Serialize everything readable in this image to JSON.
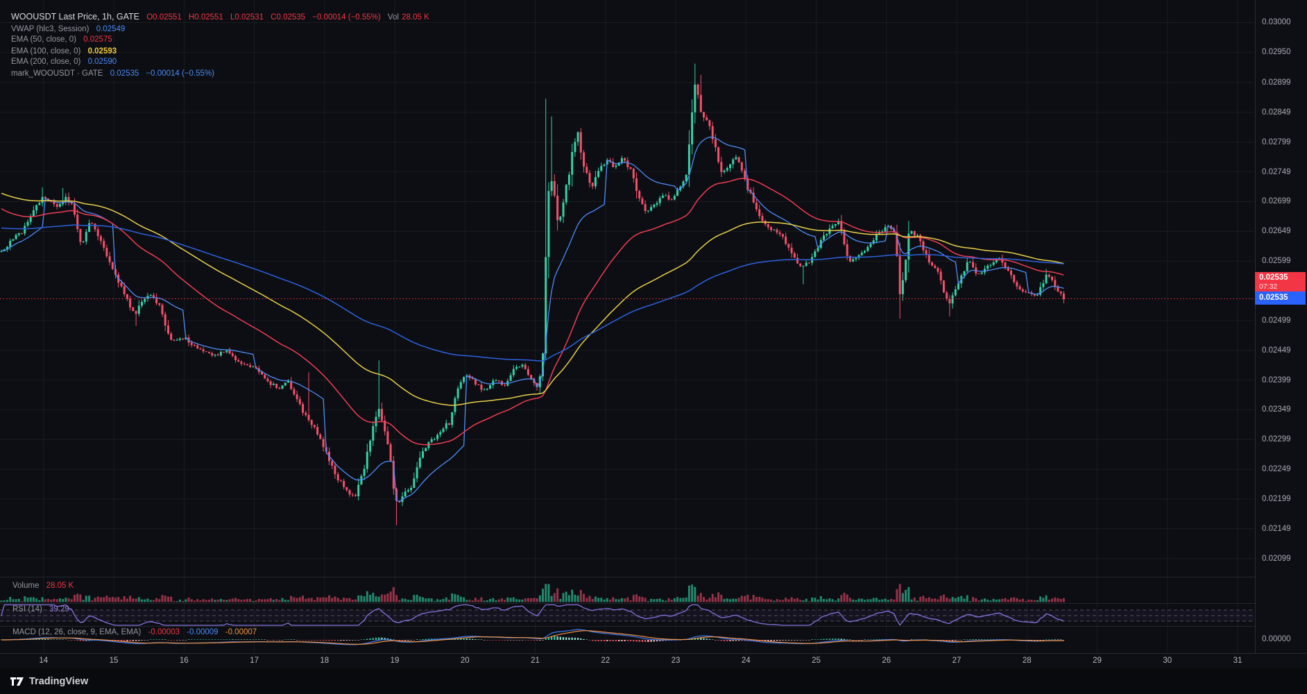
{
  "legend": {
    "row1": {
      "symbol": "WOOUSDT Last Price, 1h, GATE",
      "o": "O0.02551",
      "h": "H0.02551",
      "l": "L0.02531",
      "c": "C0.02535",
      "chg": "−0.00014 (−0.55%)",
      "vol_label": "Vol",
      "vol": "28.05 K"
    },
    "row2": {
      "name": "VWAP (hlc3, Session)",
      "value": "0.02549"
    },
    "row3": {
      "name": "EMA (50, close, 0)",
      "value": "0.02575"
    },
    "row4": {
      "name": "EMA (100, close, 0)",
      "value": "0.02593"
    },
    "row5": {
      "name": "EMA (200, close, 0)",
      "value": "0.02590"
    },
    "row6": {
      "name": "mark_WOOUSDT · GATE",
      "value": "0.02535",
      "chg": "−0.00014 (−0.55%)"
    }
  },
  "panes": {
    "volume_label": "Volume",
    "volume_value": "28.05 K",
    "rsi_label": "RSI (14)",
    "rsi_value": "39.29",
    "macd_label": "MACD (12, 26, close, 9, EMA, EMA)",
    "macd_v1": "-0.00003",
    "macd_v2": "-0.00009",
    "macd_v3": "-0.00007"
  },
  "tags": {
    "last_price": "0.02535",
    "countdown": "07:32",
    "mark_price": "0.02535"
  },
  "footer": {
    "brand": "TradingView"
  },
  "axis": {
    "price_labels": [
      "0.03000",
      "0.02950",
      "0.02899",
      "0.02849",
      "0.02799",
      "0.02749",
      "0.02699",
      "0.02649",
      "0.02599",
      "0.02499",
      "0.02449",
      "0.02399",
      "0.02349",
      "0.02299",
      "0.02249",
      "0.02199",
      "0.02149",
      "0.02099"
    ],
    "macd_zero_label": "0.00000",
    "time_labels": [
      "14",
      "15",
      "16",
      "17",
      "18",
      "19",
      "20",
      "21",
      "22",
      "23",
      "24",
      "25",
      "26",
      "27",
      "28",
      "29",
      "30",
      "31"
    ]
  },
  "colors": {
    "bg": "#0c0e13",
    "grid": "rgba(255,255,255,0.055)",
    "sep": "rgba(255,255,255,0.10)",
    "up": "#38d0a6",
    "down": "#f4506b",
    "vol_up": "#2a9d7c",
    "vol_down": "#b03a52",
    "vwap": "#4f8df7",
    "ema50": "#ef3d54",
    "ema100": "#e8d04b",
    "ema200": "#2e62e0",
    "rsi": "#8674e0",
    "rsi_guide": "#9598a1",
    "rsi_band": "rgba(126,87,194,0.08)",
    "macd_line": "#3d7bf5",
    "macd_signal": "#f59342",
    "hist_pos": "#3dbd9b",
    "hist_pos_weak": "#8fd9c4",
    "hist_neg": "#e05260",
    "hist_neg_weak": "#f0b9be",
    "last_line": "#f23645"
  },
  "chart_data": {
    "type": "candlestick",
    "title": "WOOUSDT Last Price, 1h, GATE",
    "price_axis_range": [
      0.0206,
      0.0301
    ],
    "time_domain_days": [
      13.4,
      28.54
    ],
    "bars_per_day": 24,
    "seed": 20250728,
    "last_close": 0.02535,
    "ohlc_last": {
      "o": 0.02551,
      "h": 0.02551,
      "l": 0.02531,
      "c": 0.02535,
      "change": -0.00014,
      "change_pct": -0.55,
      "volume": "28.05 K"
    },
    "indicators": [
      {
        "name": "VWAP",
        "params": "hlc3, Session",
        "last": 0.02549
      },
      {
        "name": "EMA",
        "params": "50, close, 0",
        "last": 0.02575,
        "start": 0.0269
      },
      {
        "name": "EMA",
        "params": "100, close, 0",
        "last": 0.02593,
        "start": 0.02715
      },
      {
        "name": "EMA",
        "params": "200, close, 0",
        "last": 0.0259,
        "start": 0.02655
      },
      {
        "name": "RSI",
        "params": "14",
        "last": 39.29,
        "guides": [
          70,
          50,
          30
        ]
      },
      {
        "name": "MACD",
        "params": "12, 26, close, 9, EMA, EMA",
        "last": [
          -3e-05,
          -9e-05,
          -7e-05
        ]
      }
    ],
    "price_keyframes": [
      [
        13.4,
        0.02615
      ],
      [
        13.55,
        0.02635
      ],
      [
        13.7,
        0.0265
      ],
      [
        13.85,
        0.0268
      ],
      [
        13.98,
        0.02705
      ],
      [
        14.1,
        0.027
      ],
      [
        14.22,
        0.0269
      ],
      [
        14.32,
        0.02705
      ],
      [
        14.44,
        0.02685
      ],
      [
        14.54,
        0.0262
      ],
      [
        14.66,
        0.02665
      ],
      [
        14.8,
        0.0264
      ],
      [
        14.92,
        0.026
      ],
      [
        15.05,
        0.0257
      ],
      [
        15.18,
        0.0254
      ],
      [
        15.3,
        0.02505
      ],
      [
        15.42,
        0.02535
      ],
      [
        15.55,
        0.02545
      ],
      [
        15.68,
        0.02515
      ],
      [
        15.82,
        0.02465
      ],
      [
        16.0,
        0.0247
      ],
      [
        16.15,
        0.02455
      ],
      [
        16.3,
        0.02445
      ],
      [
        16.45,
        0.0244
      ],
      [
        16.6,
        0.0245
      ],
      [
        16.75,
        0.0243
      ],
      [
        16.9,
        0.02425
      ],
      [
        17.05,
        0.02415
      ],
      [
        17.2,
        0.02395
      ],
      [
        17.35,
        0.02385
      ],
      [
        17.48,
        0.02395
      ],
      [
        17.6,
        0.02365
      ],
      [
        17.72,
        0.0234
      ],
      [
        17.8,
        0.0233
      ],
      [
        17.92,
        0.02305
      ],
      [
        18.05,
        0.0227
      ],
      [
        18.18,
        0.02235
      ],
      [
        18.3,
        0.02215
      ],
      [
        18.42,
        0.022
      ],
      [
        18.52,
        0.0223
      ],
      [
        18.64,
        0.0229
      ],
      [
        18.76,
        0.02355
      ],
      [
        18.86,
        0.0232
      ],
      [
        18.96,
        0.0224
      ],
      [
        19.04,
        0.02185
      ],
      [
        19.14,
        0.0221
      ],
      [
        19.26,
        0.02225
      ],
      [
        19.38,
        0.0228
      ],
      [
        19.5,
        0.02295
      ],
      [
        19.64,
        0.0231
      ],
      [
        19.78,
        0.0233
      ],
      [
        19.9,
        0.02385
      ],
      [
        20.02,
        0.0241
      ],
      [
        20.14,
        0.02395
      ],
      [
        20.28,
        0.0238
      ],
      [
        20.42,
        0.024
      ],
      [
        20.55,
        0.0239
      ],
      [
        20.68,
        0.02415
      ],
      [
        20.8,
        0.02425
      ],
      [
        20.92,
        0.02405
      ],
      [
        21.04,
        0.02385
      ],
      [
        21.12,
        0.0245
      ],
      [
        21.17,
        0.027
      ],
      [
        21.24,
        0.02735
      ],
      [
        21.32,
        0.02665
      ],
      [
        21.42,
        0.027
      ],
      [
        21.52,
        0.02785
      ],
      [
        21.6,
        0.02815
      ],
      [
        21.7,
        0.02755
      ],
      [
        21.8,
        0.0272
      ],
      [
        21.92,
        0.02755
      ],
      [
        22.04,
        0.0277
      ],
      [
        22.14,
        0.02755
      ],
      [
        22.24,
        0.0277
      ],
      [
        22.34,
        0.02755
      ],
      [
        22.46,
        0.02715
      ],
      [
        22.58,
        0.0268
      ],
      [
        22.7,
        0.02695
      ],
      [
        22.82,
        0.0271
      ],
      [
        22.94,
        0.027
      ],
      [
        23.06,
        0.02725
      ],
      [
        23.16,
        0.0275
      ],
      [
        23.22,
        0.0281
      ],
      [
        23.28,
        0.0291
      ],
      [
        23.36,
        0.02845
      ],
      [
        23.46,
        0.0283
      ],
      [
        23.56,
        0.02795
      ],
      [
        23.66,
        0.02745
      ],
      [
        23.78,
        0.02765
      ],
      [
        23.88,
        0.02775
      ],
      [
        23.98,
        0.0274
      ],
      [
        24.12,
        0.0269
      ],
      [
        24.26,
        0.02665
      ],
      [
        24.4,
        0.0265
      ],
      [
        24.54,
        0.02635
      ],
      [
        24.68,
        0.02605
      ],
      [
        24.8,
        0.02585
      ],
      [
        24.94,
        0.02605
      ],
      [
        25.08,
        0.02635
      ],
      [
        25.22,
        0.02655
      ],
      [
        25.34,
        0.02665
      ],
      [
        25.46,
        0.02595
      ],
      [
        25.6,
        0.02605
      ],
      [
        25.74,
        0.0262
      ],
      [
        25.88,
        0.02645
      ],
      [
        26.02,
        0.0266
      ],
      [
        26.12,
        0.0264
      ],
      [
        26.2,
        0.02535
      ],
      [
        26.32,
        0.0265
      ],
      [
        26.46,
        0.0264
      ],
      [
        26.6,
        0.026
      ],
      [
        26.74,
        0.02575
      ],
      [
        26.88,
        0.02525
      ],
      [
        27.02,
        0.02555
      ],
      [
        27.16,
        0.026
      ],
      [
        27.3,
        0.02575
      ],
      [
        27.44,
        0.0259
      ],
      [
        27.58,
        0.02605
      ],
      [
        27.72,
        0.02585
      ],
      [
        27.86,
        0.02555
      ],
      [
        28.0,
        0.02545
      ],
      [
        28.14,
        0.0254
      ],
      [
        28.28,
        0.02575
      ],
      [
        28.42,
        0.02555
      ],
      [
        28.54,
        0.02535
      ]
    ],
    "spikes": [
      [
        13.98,
        "hi",
        0.02723
      ],
      [
        14.28,
        "hi",
        0.02722
      ],
      [
        15.32,
        "lo",
        0.0249
      ],
      [
        17.78,
        "hi",
        0.02412
      ],
      [
        18.78,
        "hi",
        0.02432
      ],
      [
        19.04,
        "lo",
        0.02155
      ],
      [
        21.17,
        "hi",
        0.02872
      ],
      [
        21.24,
        "hi",
        0.02842
      ],
      [
        23.28,
        "hi",
        0.02931
      ],
      [
        23.36,
        "hi",
        0.02912
      ],
      [
        24.8,
        "lo",
        0.0256
      ],
      [
        26.2,
        "lo",
        0.02502
      ],
      [
        26.88,
        "lo",
        0.02506
      ],
      [
        28.54,
        "lo",
        0.02528
      ]
    ]
  }
}
